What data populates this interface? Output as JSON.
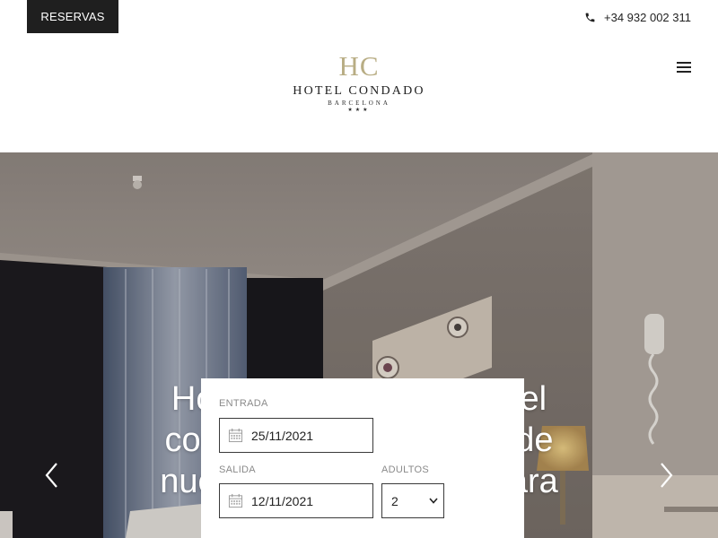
{
  "header": {
    "reservas_label": "RESERVAS",
    "phone": "+34 932 002 311",
    "logo": {
      "mark": "HC",
      "name": "HOTEL CONDADO",
      "city": "BARCELONA",
      "stars": "★★★"
    },
    "menu_icon": "hamburger-menu-icon"
  },
  "hero": {
    "title_line1": "Hotel de 3 estrellas en el",
    "title_line2": "corazón de Barcelona, de",
    "title_line3": "nueva construcción y para",
    "prev_icon": "chevron-left-icon",
    "next_icon": "chevron-right-icon"
  },
  "booking": {
    "entrada_label": "ENTRADA",
    "entrada_value": "25/11/2021",
    "salida_label": "SALIDA",
    "salida_value": "12/11/2021",
    "adultos_label": "ADULTOS",
    "adultos_value": "2",
    "calendar_icon": "calendar-icon"
  },
  "colors": {
    "accent_gold": "#b8ad84",
    "dark": "#1f1f1f"
  }
}
